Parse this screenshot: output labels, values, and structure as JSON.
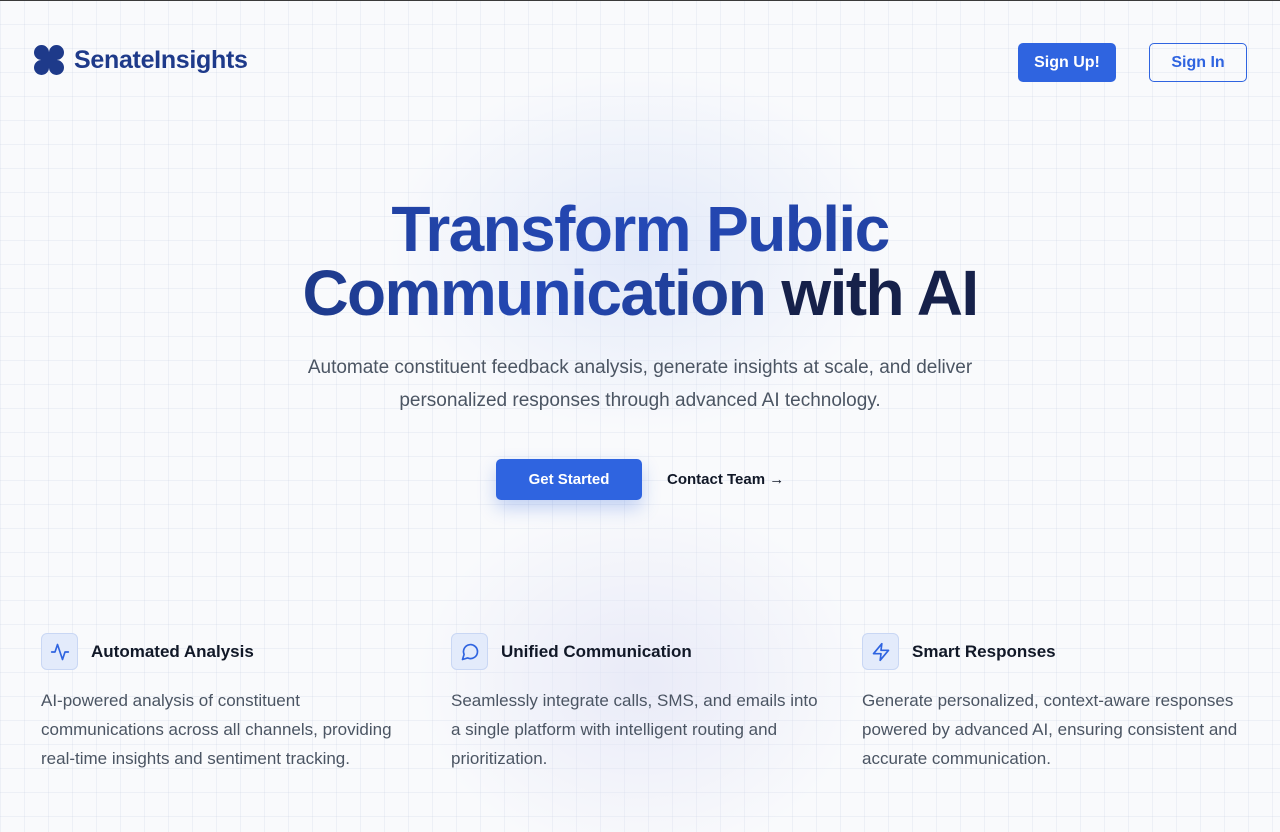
{
  "header": {
    "brand": "SenateInsights",
    "signup_label": "Sign Up!",
    "signin_label": "Sign In"
  },
  "hero": {
    "title_line1": "Transform Public",
    "title_line2_a": "Communication",
    "title_line2_b": " with AI",
    "subtitle": "Automate constituent feedback analysis, generate insights at scale, and deliver personalized responses through advanced AI technology.",
    "cta_primary": "Get Started",
    "cta_secondary": "Contact Team →"
  },
  "features": [
    {
      "icon": "activity-icon",
      "title": "Automated Analysis",
      "description": "AI-powered analysis of constituent communications across all channels, providing real-time insights and sentiment tracking."
    },
    {
      "icon": "message-circle-icon",
      "title": "Unified Communication",
      "description": "Seamlessly integrate calls, SMS, and emails into a single platform with intelligent routing and prioritization."
    },
    {
      "icon": "lightning-icon",
      "title": "Smart Responses",
      "description": "Generate personalized, context-aware responses powered by advanced AI, ensuring consistent and accurate communication."
    }
  ],
  "colors": {
    "brand_navy": "#1e3a8a",
    "primary_blue": "#2f64e0",
    "icon_bg": "#e3ebfb",
    "body_text": "#4b5563"
  }
}
